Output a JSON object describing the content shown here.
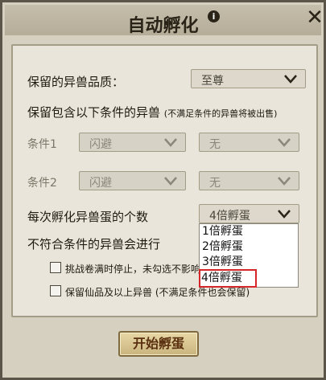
{
  "dialog": {
    "title": "自动孵化",
    "info_icon": "i"
  },
  "quality": {
    "label": "保留的异兽品质：",
    "value": "至尊"
  },
  "conditions": {
    "heading": "保留包含以下条件的异兽",
    "note": "(不满足条件的异兽将被出售)",
    "rows": [
      {
        "label": "条件1",
        "skill": "闪避",
        "option": "无"
      },
      {
        "label": "条件2",
        "skill": "闪避",
        "option": "无"
      }
    ]
  },
  "egg_count": {
    "label": "每次孵化异兽蛋的个数",
    "value": "4倍孵蛋",
    "options": [
      "1倍孵蛋",
      "2倍孵蛋",
      "3倍孵蛋",
      "4倍孵蛋"
    ]
  },
  "noncompliant": {
    "label": "不符合条件的异兽会进行",
    "options": [
      {
        "label": "挑战卷满时停止，未勾选不影响",
        "checked": false
      },
      {
        "label": "保留仙品及以上异兽 (不满足条件也会保留)",
        "checked": false
      }
    ]
  },
  "start_button": "开始孵蛋"
}
